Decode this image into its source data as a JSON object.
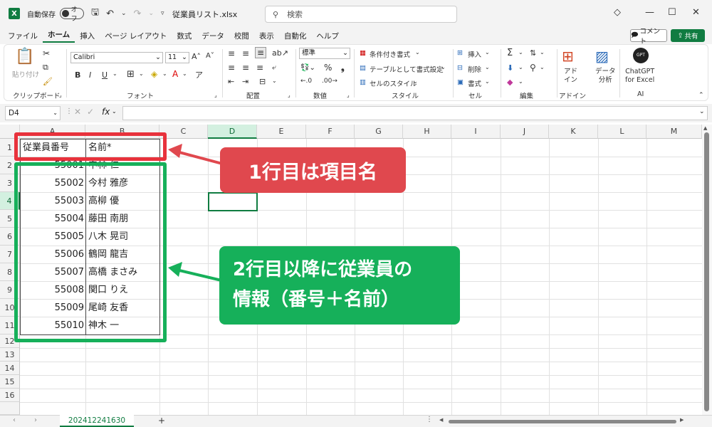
{
  "titlebar": {
    "logo": "X",
    "autosave_label": "自動保存",
    "autosave_state": "オフ",
    "filename": "従業員リスト.xlsx",
    "search_placeholder": "検索"
  },
  "menu": {
    "items": [
      "ファイル",
      "ホーム",
      "挿入",
      "ページ レイアウト",
      "数式",
      "データ",
      "校閲",
      "表示",
      "自動化",
      "ヘルプ"
    ],
    "active": "ホーム",
    "comment_label": "コメント",
    "share_label": "共有"
  },
  "ribbon": {
    "paste_label": "貼り付け",
    "clipboard_label": "クリップボード",
    "font_name": "Calibri",
    "font_size": "11",
    "font_label": "フォント",
    "align_label": "配置",
    "number_format": "標準",
    "number_label": "数値",
    "cond_format": "条件付き書式",
    "table_format": "テーブルとして書式設定",
    "cell_style": "セルのスタイル",
    "style_label": "スタイル",
    "insert": "挿入",
    "delete": "削除",
    "format": "書式",
    "cells_label": "セル",
    "edit_label": "編集",
    "addin_btn": "アド\nイン",
    "addin_label": "アドイン",
    "analysis_btn": "データ\n分析",
    "chatgpt_btn": "ChatGPT\nfor Excel",
    "ai_label": "AI"
  },
  "formula": {
    "namebox": "D4",
    "fx": "fx"
  },
  "columns": [
    "A",
    "B",
    "C",
    "D",
    "E",
    "F",
    "G",
    "H",
    "I",
    "J",
    "K",
    "L",
    "M"
  ],
  "selected_column": "D",
  "rows": [
    "1",
    "2",
    "3",
    "4",
    "5",
    "6",
    "7",
    "8",
    "9",
    "10",
    "11",
    "12",
    "13",
    "14",
    "15",
    "16"
  ],
  "selected_row": "4",
  "table": {
    "header": [
      "従業員番号",
      "名前*"
    ],
    "data": [
      [
        "55001",
        "中林 仁"
      ],
      [
        "55002",
        "今村 雅彦"
      ],
      [
        "55003",
        "高柳 優"
      ],
      [
        "55004",
        "藤田 南朋"
      ],
      [
        "55005",
        "八木 晃司"
      ],
      [
        "55006",
        "鶴岡 龍吉"
      ],
      [
        "55007",
        "高橋 まさみ"
      ],
      [
        "55008",
        "関口 りえ"
      ],
      [
        "55009",
        "尾崎 友香"
      ],
      [
        "55010",
        "神木 一"
      ]
    ]
  },
  "sheet": {
    "tab": "202412241630",
    "add": "+"
  },
  "callouts": {
    "red": "1行目は項目名",
    "green_line1": "2行目以降に従業員の",
    "green_line2": "情報（番号＋名前）",
    "red_color": "#e8323c",
    "green_color": "#16b05a"
  }
}
